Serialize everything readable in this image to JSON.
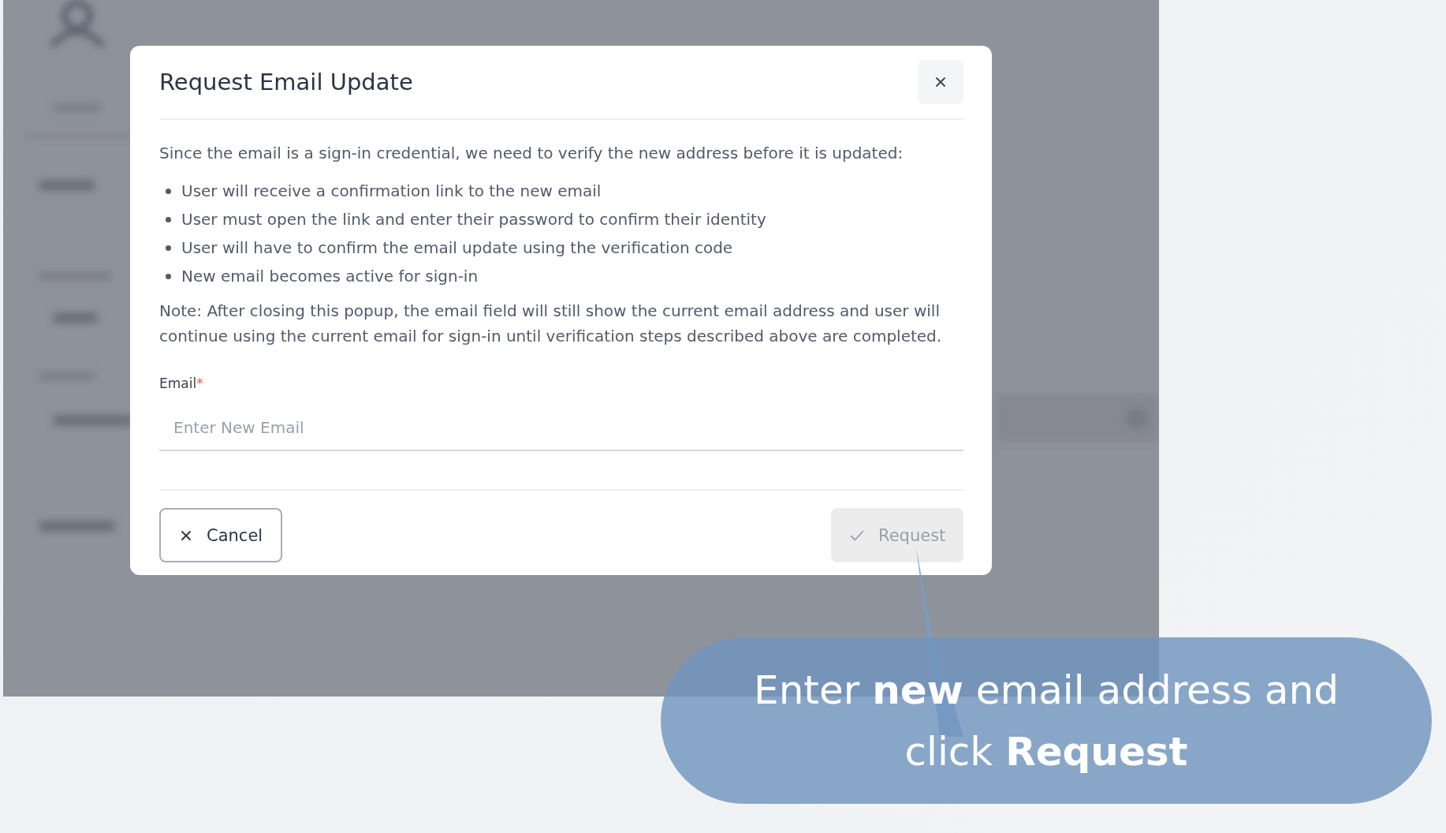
{
  "dialog": {
    "title": "Request Email Update",
    "intro": "Since the email is a sign-in credential, we need to verify the new address before it is updated:",
    "steps": [
      "User will receive a confirmation link to the new email",
      "User must open the link and enter their password to confirm their identity",
      "User will have to confirm the email update using the verification code",
      "New email becomes active for sign-in"
    ],
    "note": "Note: After closing this popup, the email field will still show the current email address and user will continue using the current email for sign-in until verification steps described above are completed.",
    "field": {
      "label": "Email",
      "required_mark": "*",
      "placeholder": "Enter New Email"
    },
    "buttons": [
      {
        "kind": "cancel",
        "label": "Cancel",
        "disabled": false
      },
      {
        "kind": "confirm",
        "label": "Request",
        "disabled": true
      }
    ]
  },
  "callout": {
    "text": "Enter **new** email address and click **Request**"
  }
}
